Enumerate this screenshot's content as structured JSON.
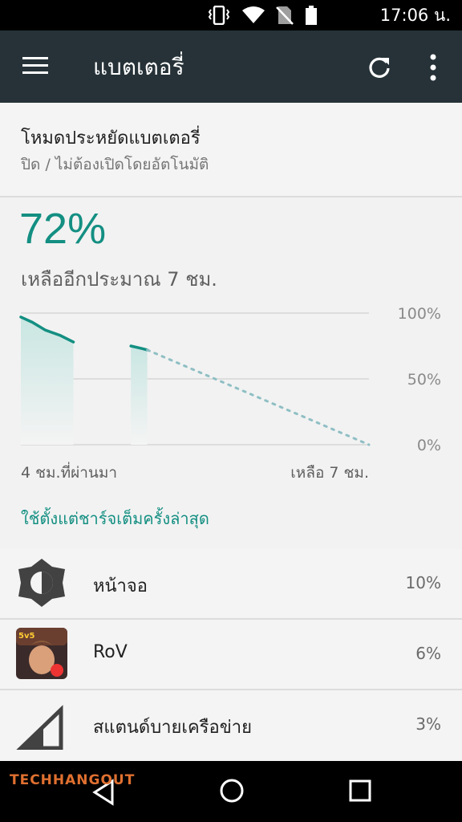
{
  "status": {
    "time": "17:06 น."
  },
  "appbar": {
    "title": "แบตเตอรี่"
  },
  "saver": {
    "title": "โหมดประหยัดแบตเตอรี่",
    "subtitle": "ปิด / ไม่ต้องเปิดโดยอัตโนมัติ"
  },
  "battery": {
    "percent": "72%",
    "remaining": "เหลืออีกประมาณ 7 ชม."
  },
  "chart_data": {
    "type": "line",
    "title": "",
    "y_ticks": [
      "100%",
      "50%",
      "0%"
    ],
    "ylim": [
      0,
      100
    ],
    "x_label_left": "4 ชม.ที่ผ่านมา",
    "x_label_right": "เหลือ 7 ชม.",
    "series": [
      {
        "kind": "history",
        "points": [
          [
            0,
            97
          ],
          [
            0.35,
            93
          ],
          [
            0.75,
            87
          ],
          [
            1.2,
            83
          ],
          [
            1.6,
            78
          ]
        ]
      },
      {
        "kind": "history",
        "points": [
          [
            3.35,
            75
          ],
          [
            3.7,
            73
          ],
          [
            3.85,
            72
          ]
        ]
      },
      {
        "kind": "projection",
        "points": [
          [
            3.85,
            72
          ],
          [
            10.6,
            0
          ]
        ]
      }
    ],
    "x_range": [
      0,
      10.6
    ],
    "colors": {
      "line": "#138f82",
      "fill": "#d5ece9",
      "grid": "#d6d6d6",
      "projection": "#8fbfc4"
    }
  },
  "usage_link": "ใช้ตั้งแต่ชาร์จเต็มครั้งล่าสุด",
  "usage": [
    {
      "label": "หน้าจอ",
      "value": "10%",
      "icon": "brightness-icon"
    },
    {
      "label": "RoV",
      "value": "6%",
      "icon": "rov-app-icon"
    },
    {
      "label": "สแตนด์บายเครือข่าย",
      "value": "3%",
      "icon": "cell-signal-icon"
    }
  ],
  "watermark": "TECHHANGOUT"
}
